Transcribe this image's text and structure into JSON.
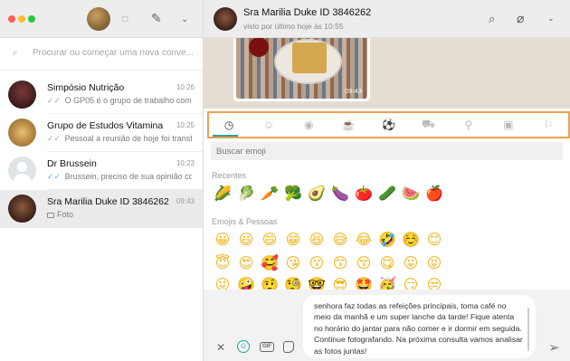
{
  "sidebar": {
    "search_placeholder": "Procurar ou começar uma nova conve...",
    "chats": [
      {
        "name": "Simpósio Nutrição",
        "time": "10:26",
        "tick": "✓✓",
        "preview": "O GP05 é o grupo de trabalho com ..."
      },
      {
        "name": "Grupo de Estudos Vitamina",
        "time": "10:25",
        "tick": "✓✓",
        "preview": "Pessoal a reunião de hoje foi transf..."
      },
      {
        "name": "Dr Brussein",
        "time": "10:23",
        "tick": "✓✓",
        "preview": "Brussein, preciso de sua opinião co..."
      },
      {
        "name": "Sra Marilia Duke ID 3846262",
        "time": "09:43",
        "preview": "Foto"
      }
    ]
  },
  "conversation": {
    "contact_name": "Sra Marilia Duke ID 3846262",
    "contact_status": "visto por último hoje às 10:55",
    "photo_time": "09:43"
  },
  "emoji_panel": {
    "search_placeholder": "Buscar emoji",
    "recent_label": "Recentes",
    "people_label": "Emojis & Pessoas",
    "tabs": [
      "recent-clock-icon",
      "smiley-icon",
      "animal-icon",
      "food-icon",
      "ball-icon",
      "car-icon",
      "bulb-icon",
      "symbols-icon",
      "flag-icon"
    ],
    "recent": [
      "🌽",
      "🥬",
      "🥕",
      "🥦",
      "🥑",
      "🍆",
      "🍅",
      "🥒",
      "🍉",
      "🍎"
    ],
    "people_row1": [
      "😀",
      "😃",
      "😄",
      "😁",
      "😆",
      "😅",
      "😂",
      "🤣",
      "☺️",
      "😊"
    ],
    "people_row2": [
      "😇",
      "😍",
      "🥰",
      "😘",
      "😗",
      "😙",
      "😚",
      "😋",
      "😛",
      "😝"
    ],
    "people_row3": [
      "😜",
      "🤪",
      "🤨",
      "🧐",
      "🤓",
      "😎",
      "🤩",
      "🥳",
      "😏",
      "😒"
    ]
  },
  "composer": {
    "message": "senhora faz todas as refeições principais, toma café no meio da manhã e um super lanche da tarde! Fique atenta no horário do jantar para não comer e ir dormir em seguida. Continue fotografando. Na próxima consulta vamos analisar as fotos juntas!",
    "gif_label": "GIF"
  },
  "colors": {
    "accent": "#26a69a",
    "highlight_border": "#f0a050",
    "header_bg": "#ededed",
    "selected_chat_bg": "#ebebeb"
  }
}
